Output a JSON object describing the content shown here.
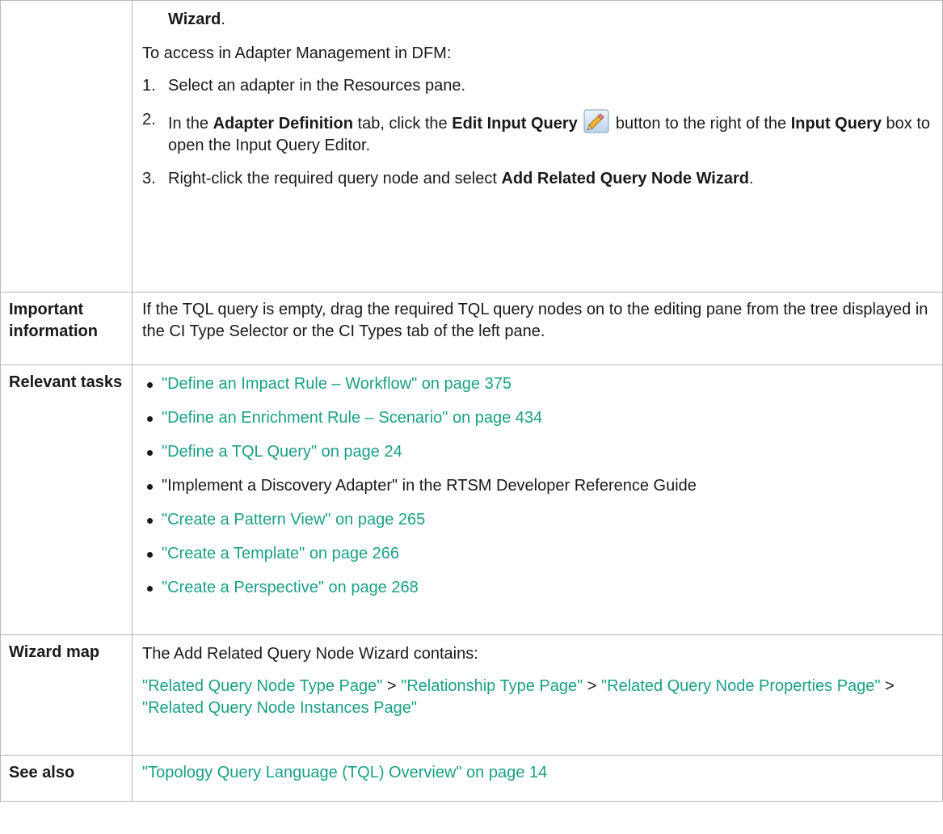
{
  "access": {
    "wizard_cont": "Wizard",
    "intro": "To access in Adapter Management in DFM:",
    "steps": {
      "s1": {
        "num": "1.",
        "text": "Select an adapter in the Resources pane."
      },
      "s2": {
        "num": "2.",
        "t1": "In the ",
        "b1": "Adapter Definition",
        "t2": " tab, click the ",
        "b2": "Edit Input Query",
        "t3": " button to the right of the ",
        "b3": "Input Query",
        "t4": " box to open the Input Query Editor."
      },
      "s3": {
        "num": "3.",
        "t1": "Right-click the required query node and select ",
        "b1": "Add Related Query Node Wizard",
        "t2": "."
      }
    }
  },
  "rows": {
    "important": {
      "label": "Important information",
      "text": "If the TQL query is empty, drag the required TQL query nodes on to the editing pane from the tree displayed in the CI Type Selector or the CI Types tab of the left pane."
    },
    "tasks": {
      "label": "Relevant tasks",
      "items": [
        "\"Define an Impact Rule – Workflow\" on page 375",
        "\"Define an Enrichment Rule – Scenario\" on page 434",
        "\"Define a TQL Query\" on page 24",
        "\"Implement a Discovery Adapter\" in the RTSM Developer Reference Guide",
        "\"Create a Pattern View\" on page 265",
        "\"Create a Template\" on page 266",
        "\"Create a Perspective\" on page 268"
      ]
    },
    "wizard_map": {
      "label": "Wizard map",
      "intro": "The Add Related Query Node Wizard contains:",
      "link1": "\"Related Query Node Type Page\"",
      "sep1": " > ",
      "link2": "\"Relationship Type Page\"",
      "sep2": " > ",
      "link3": "\"Related Query Node Properties Page\"",
      "sep3": " > ",
      "link4": "\"Related Query Node Instances Page\""
    },
    "see_also": {
      "label": "See also",
      "link": "\"Topology Query Language (TQL) Overview\" on page 14"
    }
  },
  "colors": {
    "link": "#1aa085",
    "border": "#b9b9b9"
  },
  "icons": {
    "edit_input_query": "pencil-icon"
  }
}
